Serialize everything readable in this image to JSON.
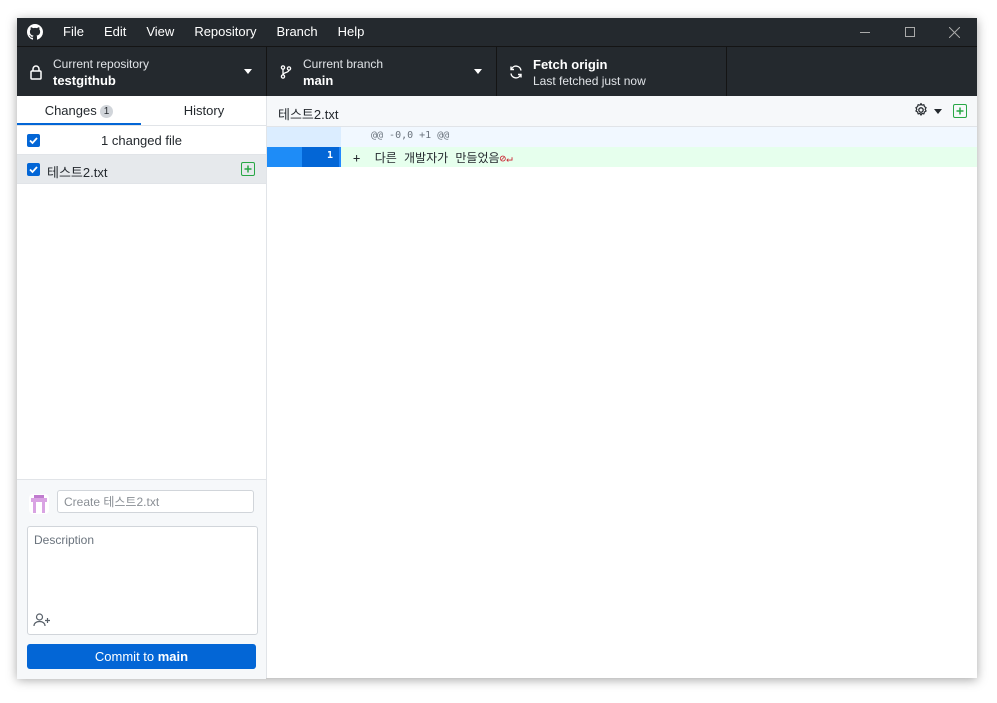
{
  "menu": [
    "File",
    "Edit",
    "View",
    "Repository",
    "Branch",
    "Help"
  ],
  "toolbar": {
    "repo_label": "Current repository",
    "repo_value": "testgithub",
    "branch_label": "Current branch",
    "branch_value": "main",
    "fetch_label": "Fetch origin",
    "fetch_status": "Last fetched just now"
  },
  "sidebar": {
    "tabs": [
      {
        "label": "Changes",
        "badge": "1"
      },
      {
        "label": "History"
      }
    ],
    "changed_summary": "1 changed file",
    "files": [
      {
        "name": "테스트2.txt",
        "status": "added",
        "checked": true
      }
    ]
  },
  "commit": {
    "summary_placeholder": "Create 테스트2.txt",
    "description_placeholder": "Description",
    "button_prefix": "Commit to ",
    "button_branch": "main"
  },
  "diff": {
    "file_path": "테스트2.txt",
    "hunk_header": "@@ -0,0 +1 @@",
    "lines": [
      {
        "new_line_number": "1",
        "marker": "+",
        "text": "다른 개발자가 만들었음"
      }
    ]
  },
  "colors": {
    "accent": "#0366d6",
    "added_bg": "#e6ffed",
    "added_icon": "#28a745",
    "toolbar_bg": "#24292e"
  }
}
